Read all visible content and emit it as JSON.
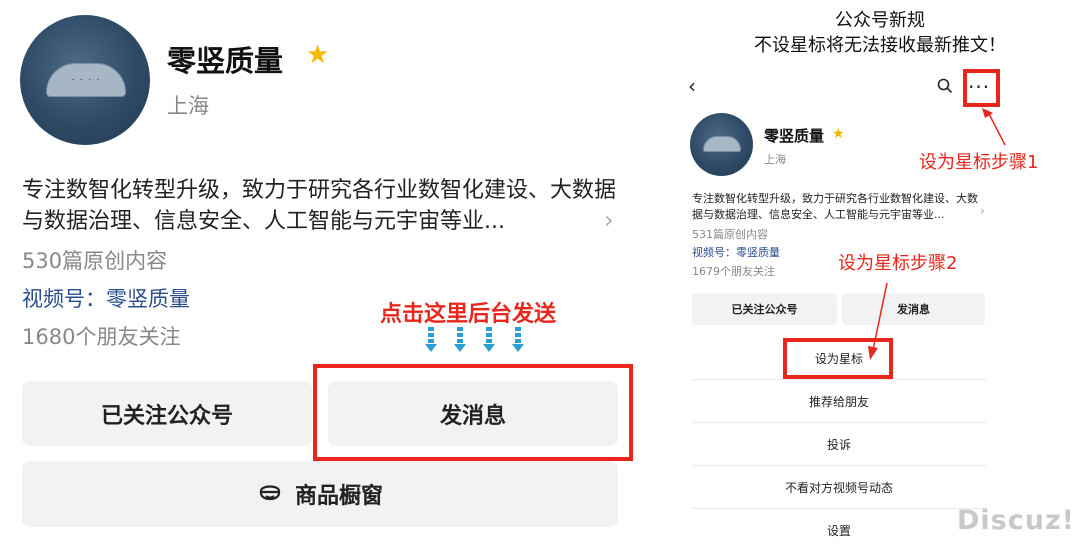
{
  "left_panel": {
    "account_name": "零竖质量",
    "location": "上海",
    "description": "专注数智化转型升级，致力于研究各行业数智化建设、大数据与数据治理、信息安全、人工智能与元宇宙等业...",
    "original_count": "530篇原创内容",
    "video_account": "视频号：零竖质量",
    "friends_following": "1680个朋友关注",
    "annotation": "点击这里后台发送",
    "follow_button": "已关注公众号",
    "message_button": "发消息",
    "shop_button": "商品橱窗"
  },
  "right_panel": {
    "heading_line1": "公众号新规",
    "heading_line2": "不设星标将无法接收最新推文！",
    "account_name": "零竖质量",
    "location": "上海",
    "description": "专注数智化转型升级，致力于研究各行业数智化建设、大数据与数据治理、信息安全、人工智能与元宇宙等业...",
    "original_count": "531篇原创内容",
    "video_account": "视频号：零竖质量",
    "friends_following": "1679个朋友关注",
    "annotation_step1": "设为星标步骤1",
    "annotation_step2": "设为星标步骤2",
    "follow_button": "已关注公众号",
    "message_button": "发消息",
    "menu": [
      "设为星标",
      "推荐给朋友",
      "投诉",
      "不看对方视频号动态",
      "设置"
    ]
  },
  "watermark": "Discuz!",
  "icons": [
    "star-icon",
    "back-icon",
    "search-icon",
    "more-icon",
    "chevron-right-icon",
    "down-arrow-icon",
    "shop-icon"
  ],
  "colors": {
    "accent_red": "#e8261c",
    "star_yellow": "#f5b800",
    "link_blue": "#2a4d8f",
    "arrow_teal": "#2a9fd1",
    "button_gray": "#f2f2f2"
  }
}
